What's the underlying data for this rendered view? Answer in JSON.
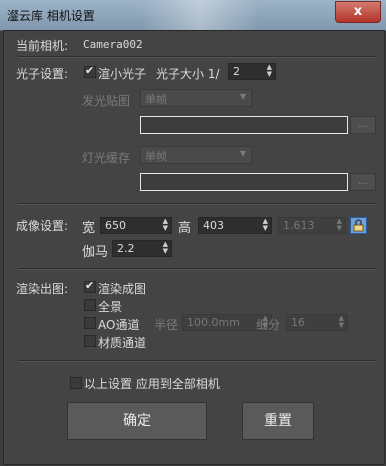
{
  "window": {
    "title": "瀣云库 相机设置",
    "close_glyph": "x"
  },
  "camera": {
    "label": "当前相机:",
    "value": "Camera002"
  },
  "photon": {
    "label": "光子设置:",
    "render_small_label": "渲小光子",
    "size_label": "光子大小 1/",
    "size_value": "2",
    "emission_map_label": "发光贴图",
    "emission_map_value": "单帧",
    "light_cache_label": "灯光缓存",
    "light_cache_value": "单帧",
    "browse_label": "..."
  },
  "imaging": {
    "label": "成像设置:",
    "width_label": "宽",
    "width_value": "650",
    "height_label": "高",
    "height_value": "403",
    "ratio_value": "1.613",
    "gamma_label": "伽马",
    "gamma_value": "2.2"
  },
  "render_output": {
    "label": "渲染出图:",
    "render_image_label": "渲染成图",
    "panorama_label": "全景",
    "ao_label": "AO通道",
    "radius_label": "半径",
    "radius_value": "100.0mm",
    "subdiv_label": "细分",
    "subdiv_value": "16",
    "material_label": "材质通道"
  },
  "apply_all_label": "以上设置 应用到全部相机",
  "buttons": {
    "ok": "确定",
    "reset": "重置"
  }
}
